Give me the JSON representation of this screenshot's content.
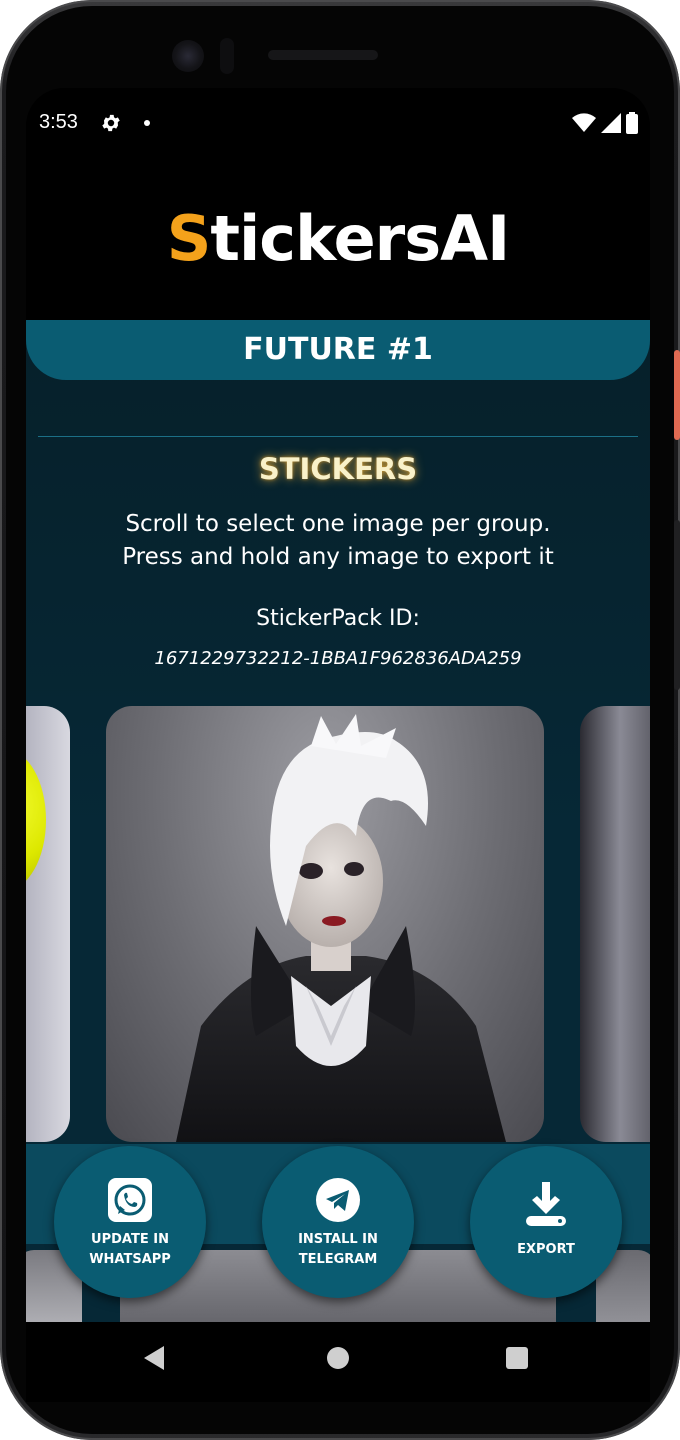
{
  "status_bar": {
    "time": "3:53",
    "icons": [
      "settings-icon",
      "notification-dot",
      "wifi-icon",
      "signal-icon",
      "battery-icon"
    ]
  },
  "header": {
    "logo_first": "S",
    "logo_rest": "tickersAI",
    "accent_color": "#f4a21b"
  },
  "pack": {
    "title": "FUTURE #1"
  },
  "stickers": {
    "section_title": "STICKERS",
    "instruction_line1": "Scroll to select one image per group.",
    "instruction_line2": "Press and hold any image to export it",
    "id_label": "StickerPack ID:",
    "id_value": "1671229732212-1BBA1F962836ADA259"
  },
  "actions": {
    "whatsapp_line1": "UPDATE IN",
    "whatsapp_line2": "WHATSAPP",
    "telegram_line1": "INSTALL IN",
    "telegram_line2": "TELEGRAM",
    "export_label": "EXPORT"
  },
  "nav": {
    "icons": [
      "back-icon",
      "home-icon",
      "recents-icon"
    ]
  },
  "colors": {
    "primary": "#0a5c72",
    "background": "#062836",
    "header_bg": "#000000"
  }
}
